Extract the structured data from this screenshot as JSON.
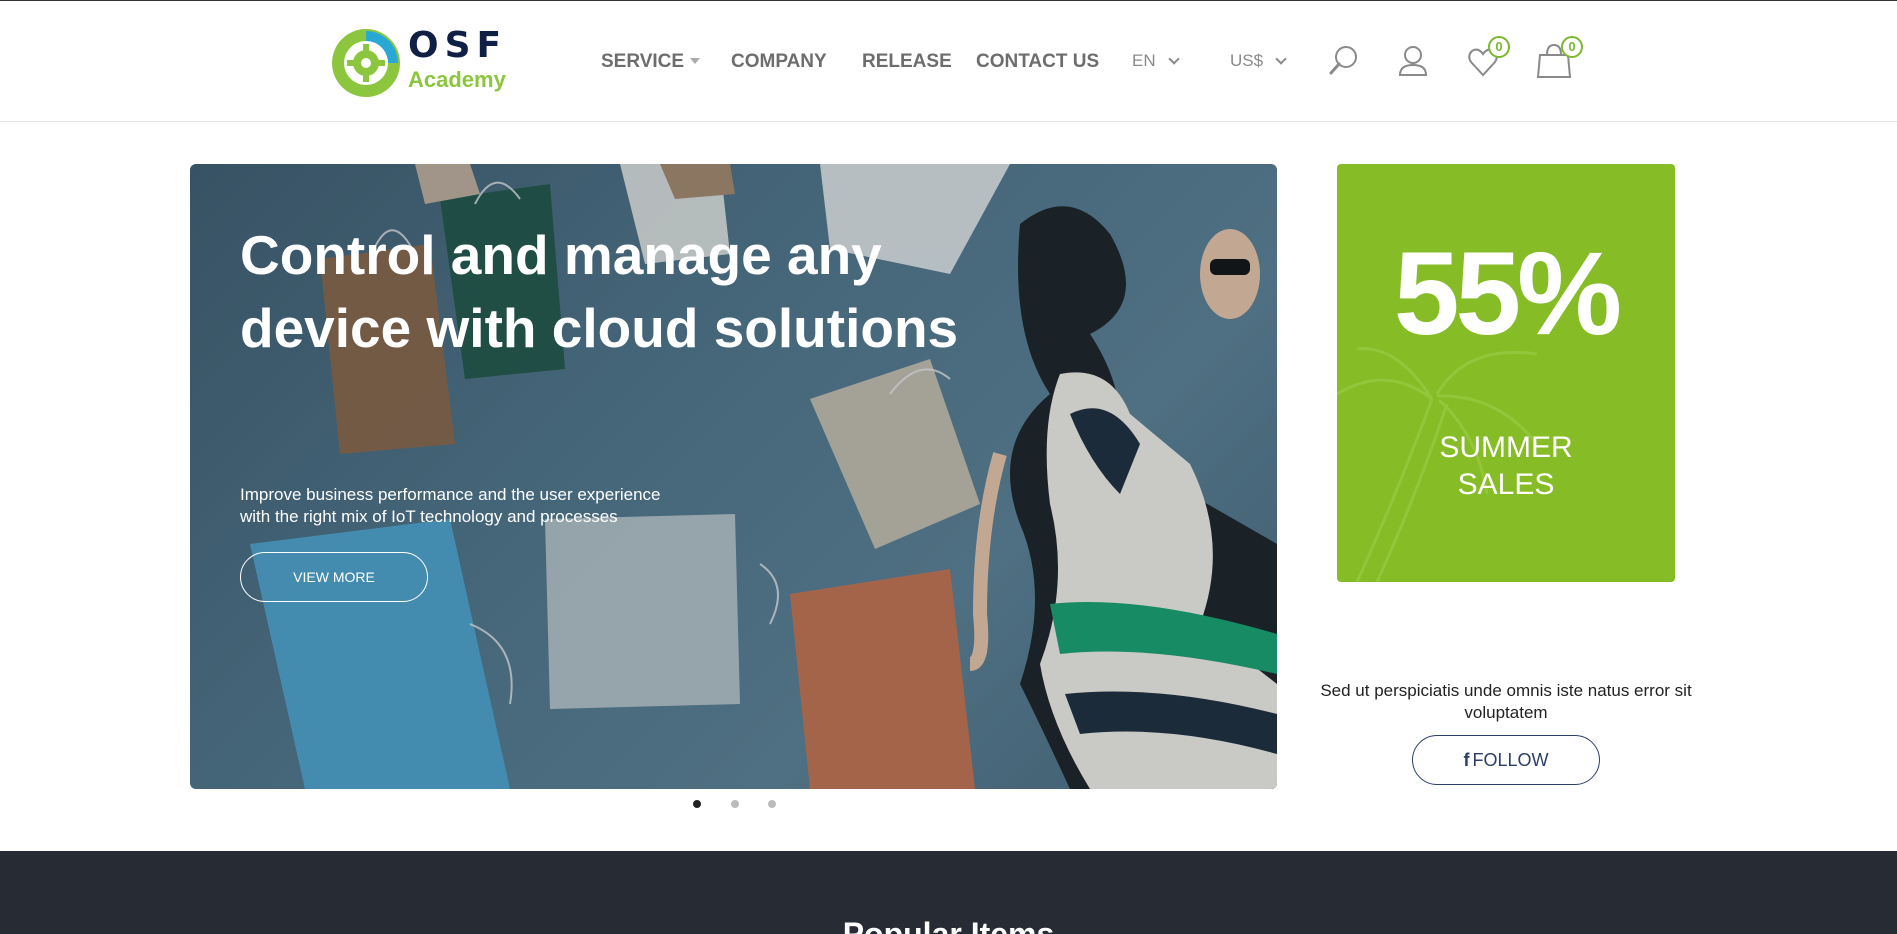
{
  "header": {
    "logo": {
      "name": "OSF",
      "sub": "Academy"
    },
    "nav": [
      {
        "label": "SERVICE"
      },
      {
        "label": "COMPANY"
      },
      {
        "label": "RELEASE"
      },
      {
        "label": "CONTACT US"
      }
    ],
    "language": "EN",
    "currency": "US$",
    "wishlist_count": "0",
    "cart_count": "0"
  },
  "hero": {
    "title_line1": "Control and manage any",
    "title_line2": "device with cloud solutions",
    "text_line1": "Improve business performance and the user experience",
    "text_line2": "with the right mix of IoT technology and processes",
    "button": "VIEW MORE",
    "slides": 3,
    "active_slide": 1
  },
  "promo": {
    "percent": "55%",
    "line1": "SUMMER",
    "line2": "SALES",
    "color": "#86bc25"
  },
  "follow": {
    "text_line1": "Sed ut perspiciatis unde omnis iste natus error sit",
    "text_line2": "voluptatem",
    "icon": "f",
    "button": "FOLLOW"
  },
  "section": {
    "title": "Popular Items"
  },
  "colors": {
    "accent": "#7cb82f",
    "dark": "#272b33",
    "navy": "#0f1f45"
  }
}
